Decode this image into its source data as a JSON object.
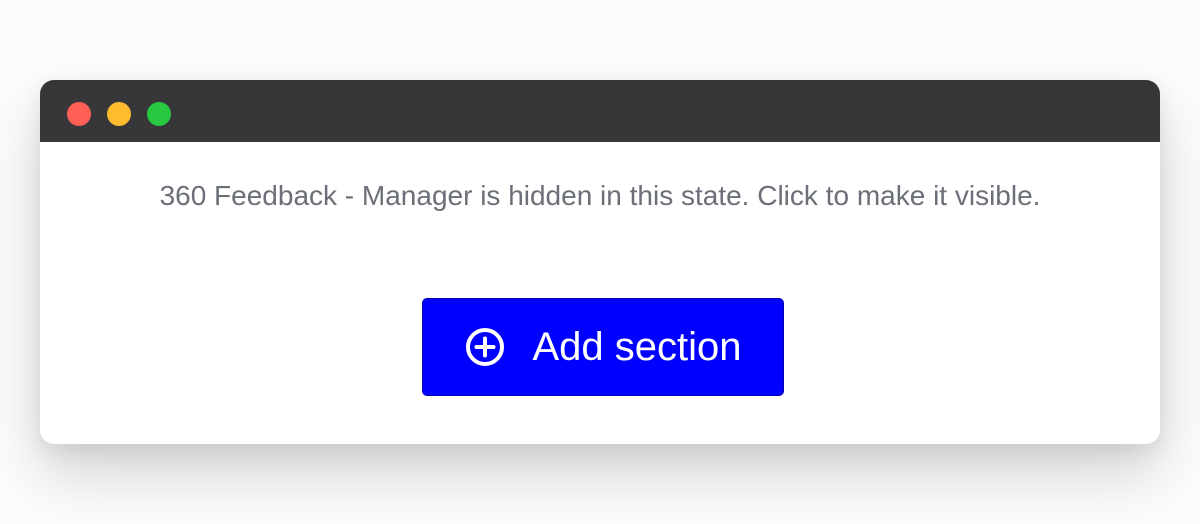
{
  "colors": {
    "titlebar": "#373739",
    "close_dot": "#fe5f57",
    "minimize_dot": "#febc2e",
    "zoom_dot": "#28c840",
    "accent": "#0000ff",
    "message_text": "#6b6f78"
  },
  "window": {
    "controls": [
      "close-dot",
      "minimize-dot",
      "zoom-dot"
    ]
  },
  "main": {
    "hidden_message": "360 Feedback - Manager is hidden in this state. Click to make it visible.",
    "add_section": {
      "label": "Add section",
      "icon": "plus-circle-icon"
    }
  }
}
